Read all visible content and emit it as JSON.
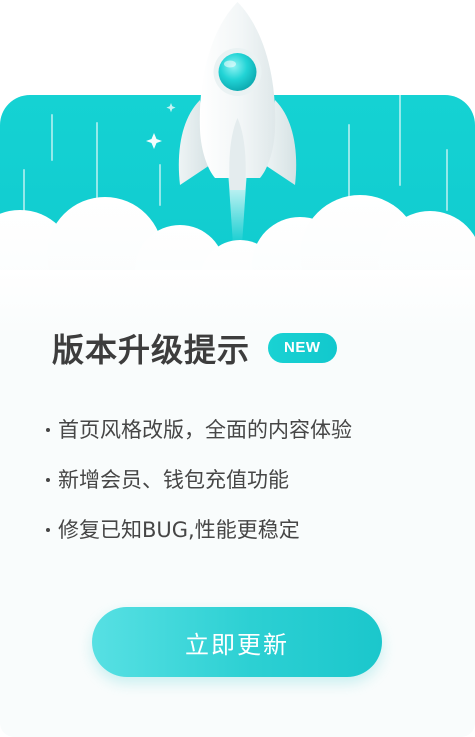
{
  "dialog": {
    "title": "版本升级提示",
    "badge": "NEW",
    "features": [
      "首页风格改版，全面的内容体验",
      "新增会员、钱包充值功能",
      "修复已知BUG,性能更稳定"
    ],
    "update_button": "立即更新"
  },
  "colors": {
    "accent": "#14cfd1",
    "title_text": "#3d3d3d",
    "body_text": "#464646",
    "card_bg": "#f9fcfc"
  },
  "icons": {
    "hero": "rocket-icon",
    "sparkles": "sparkle-icon"
  }
}
